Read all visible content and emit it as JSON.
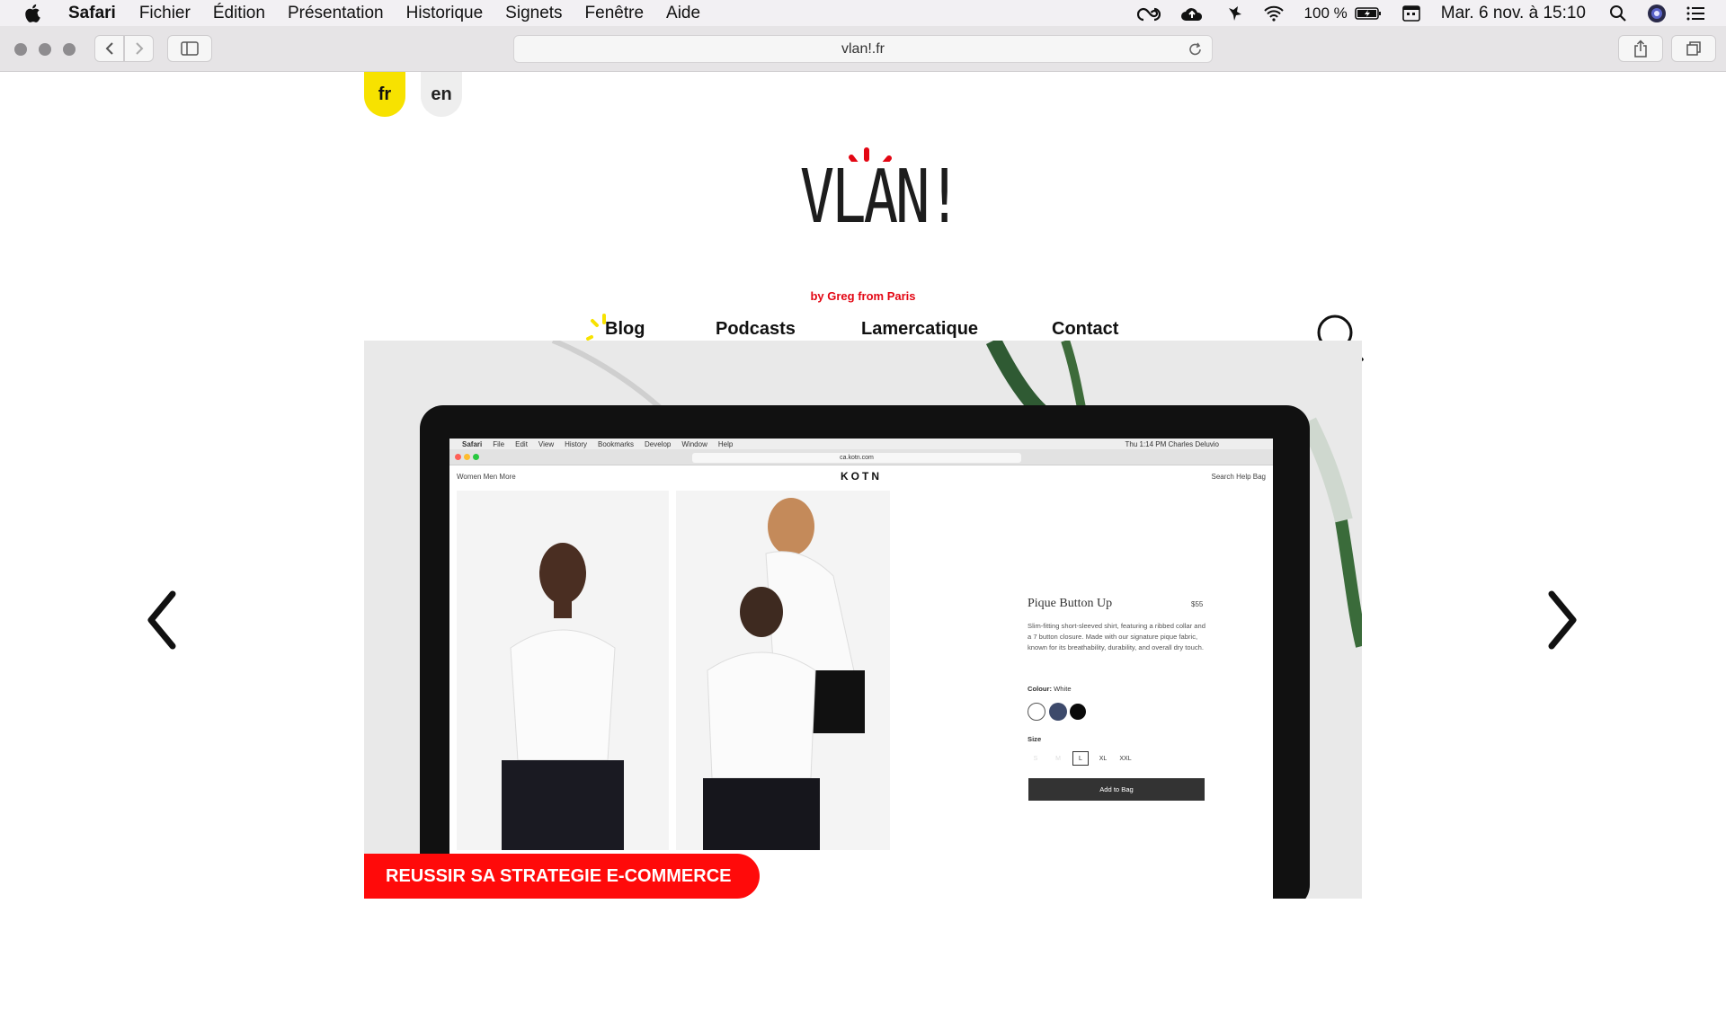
{
  "menubar": {
    "app": "Safari",
    "items": [
      "Fichier",
      "Édition",
      "Présentation",
      "Historique",
      "Signets",
      "Fenêtre",
      "Aide"
    ],
    "battery": "100 %",
    "datetime": "Mar. 6 nov. à  15:10"
  },
  "browser": {
    "url": "vlan!.fr"
  },
  "site": {
    "lang_fr": "fr",
    "lang_en": "en",
    "logo_text": "VLAN!",
    "logo_sub": "by Greg from Paris",
    "nav": {
      "blog": "Blog",
      "podcasts": "Podcasts",
      "lamercatique": "Lamercatique",
      "contact": "Contact"
    },
    "hero_caption": "REUSSIR SA STRATEGIE E-COMMERCE"
  },
  "screen_mock": {
    "menu": [
      "Safari",
      "File",
      "Edit",
      "View",
      "History",
      "Bookmarks",
      "Develop",
      "Window",
      "Help"
    ],
    "status_right": "Thu 1:14 PM   Charles Deluvio",
    "url": "ca.kotn.com",
    "nav_left": "Women   Men   More",
    "brand": "KOTN",
    "nav_right": "Search   Help   Bag",
    "product_title": "Pique Button Up",
    "product_price": "$55",
    "product_desc": "Slim-fitting short-sleeved shirt, featuring a ribbed collar and a 7 button closure. Made with our signature pique fabric, known for its breathability, durability, and overall dry touch.",
    "colour_label": "Colour:",
    "colour_value": "White",
    "size_label": "Size",
    "sizes": [
      "S",
      "M",
      "L",
      "XL",
      "XXL"
    ],
    "add_to_bag": "Add to Bag"
  },
  "colors": {
    "accent_yellow": "#f7e200",
    "accent_red": "#ff0a0a",
    "logo_red": "#e30613"
  }
}
